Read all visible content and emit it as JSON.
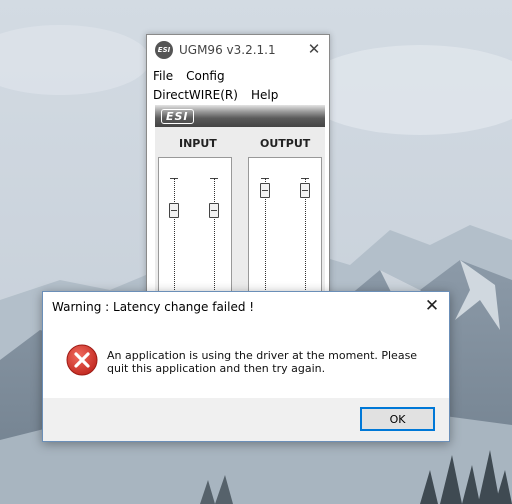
{
  "ugm_window": {
    "title": "UGM96 v3.2.1.1",
    "logo_text": "ESI",
    "menu": [
      "File",
      "Config",
      "DirectWIRE(R)",
      "Help"
    ],
    "banner_logo": "ESI",
    "input_label": "INPUT",
    "output_label": "OUTPUT",
    "close_icon": "close-icon"
  },
  "dialog": {
    "title": "Warning : Latency change failed !",
    "message": "An application is using the driver at the moment. Please quit this application and then try again.",
    "icon": "error-icon",
    "ok_label": "OK",
    "close_icon": "close-icon"
  },
  "colors": {
    "error_red": "#d9302b",
    "button_focus_border": "#0078d7",
    "dialog_footer": "#f0f0f0"
  }
}
